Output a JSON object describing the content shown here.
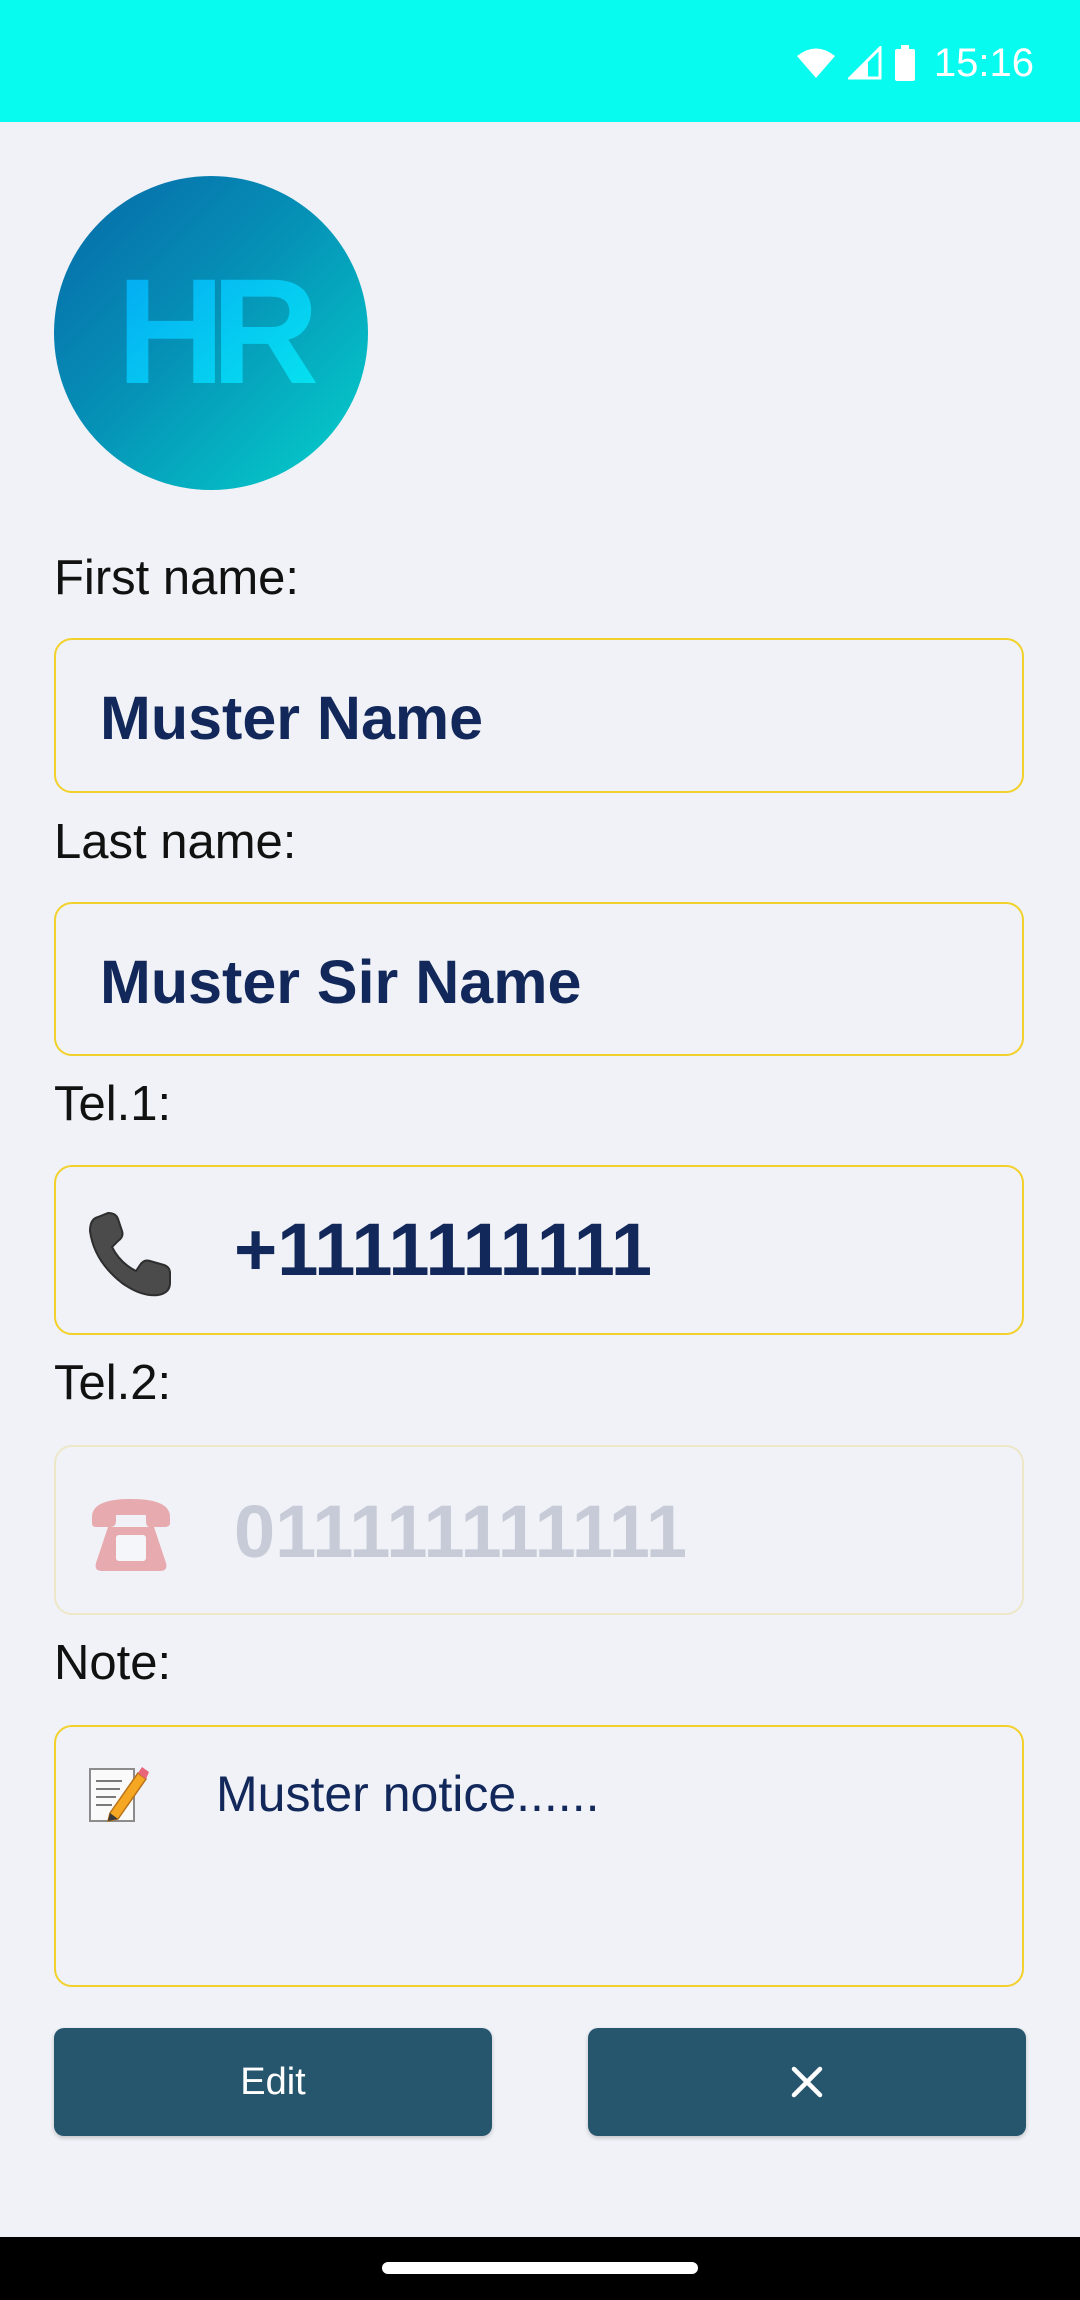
{
  "status_bar": {
    "time": "15:16",
    "background": "#07fcef",
    "icons": [
      "wifi-icon",
      "cellular-signal-icon",
      "battery-icon"
    ]
  },
  "avatar": {
    "logo_text": "HR"
  },
  "form": {
    "first_name": {
      "label": "First name:",
      "value": "Muster Name"
    },
    "last_name": {
      "label": "Last name:",
      "value": "Muster Sir Name"
    },
    "tel1": {
      "label": "Tel.1:",
      "icon": "phone-icon",
      "value": "+1111111111"
    },
    "tel2": {
      "label": "Tel.2:",
      "icon": "telephone-icon",
      "value": "011111111111",
      "disabled": true
    },
    "note": {
      "label": "Note:",
      "icon": "memo-icon",
      "value": "Muster notice......"
    }
  },
  "actions": {
    "edit_label": "Edit",
    "close_label": "✕"
  },
  "colors": {
    "field_border": "#f2d12c",
    "field_text": "#13285a",
    "button_bg": "#26566d",
    "page_bg": "#f0f2f7"
  }
}
